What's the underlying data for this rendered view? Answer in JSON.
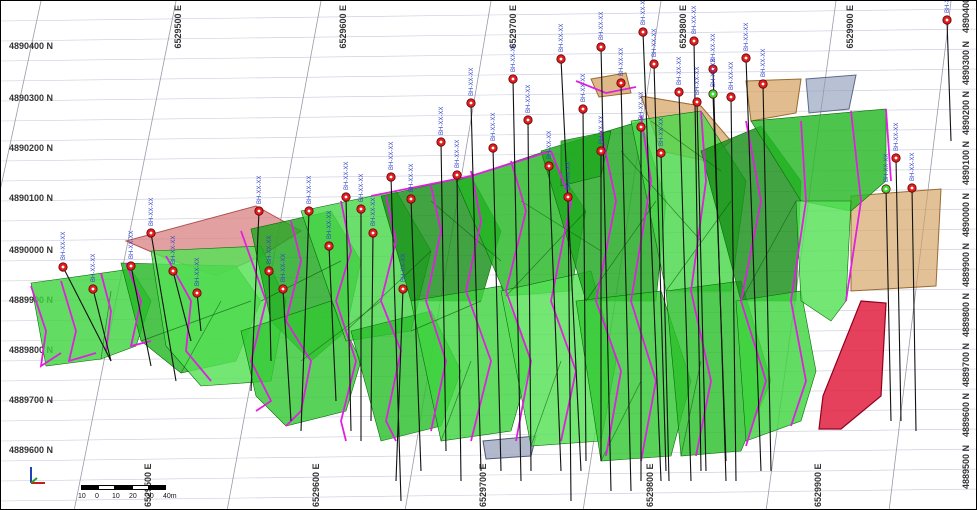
{
  "viewport": {
    "easting_labels": [
      "6529500 E",
      "6529600 E",
      "6529700 E",
      "6529800 E",
      "6529900 E"
    ],
    "northing_labels_left": [
      "4890400 N",
      "4890300 N",
      "4890200 N",
      "4890100 N",
      "4890000 N",
      "4889900 N",
      "4889800 N",
      "4889700 N",
      "4889600 N"
    ],
    "northing_labels_right": [
      "4890400 N",
      "4890300 N",
      "4890200 N",
      "4890100 N",
      "4890000 N",
      "4889900 N",
      "4889800 N",
      "4889700 N",
      "4889600 N",
      "4889500 N"
    ],
    "top_easting_labels": [
      "6529500 E",
      "6529600 E",
      "6529700 E",
      "6529800 E",
      "6529900 E"
    ],
    "hole_label_text": "BH-XX-XX"
  },
  "scalebar": {
    "ticks": [
      "10",
      "0",
      "10",
      "20",
      "30",
      "40m"
    ]
  },
  "colors": {
    "solid_green": "#2ecc2e",
    "outline_magenta": "#e020e0",
    "collar_red": "#e02020",
    "grid_line": "#c8c8dc",
    "orange_block": "#d4a060",
    "pink_block": "#d88080",
    "red_block": "#e02040"
  }
}
